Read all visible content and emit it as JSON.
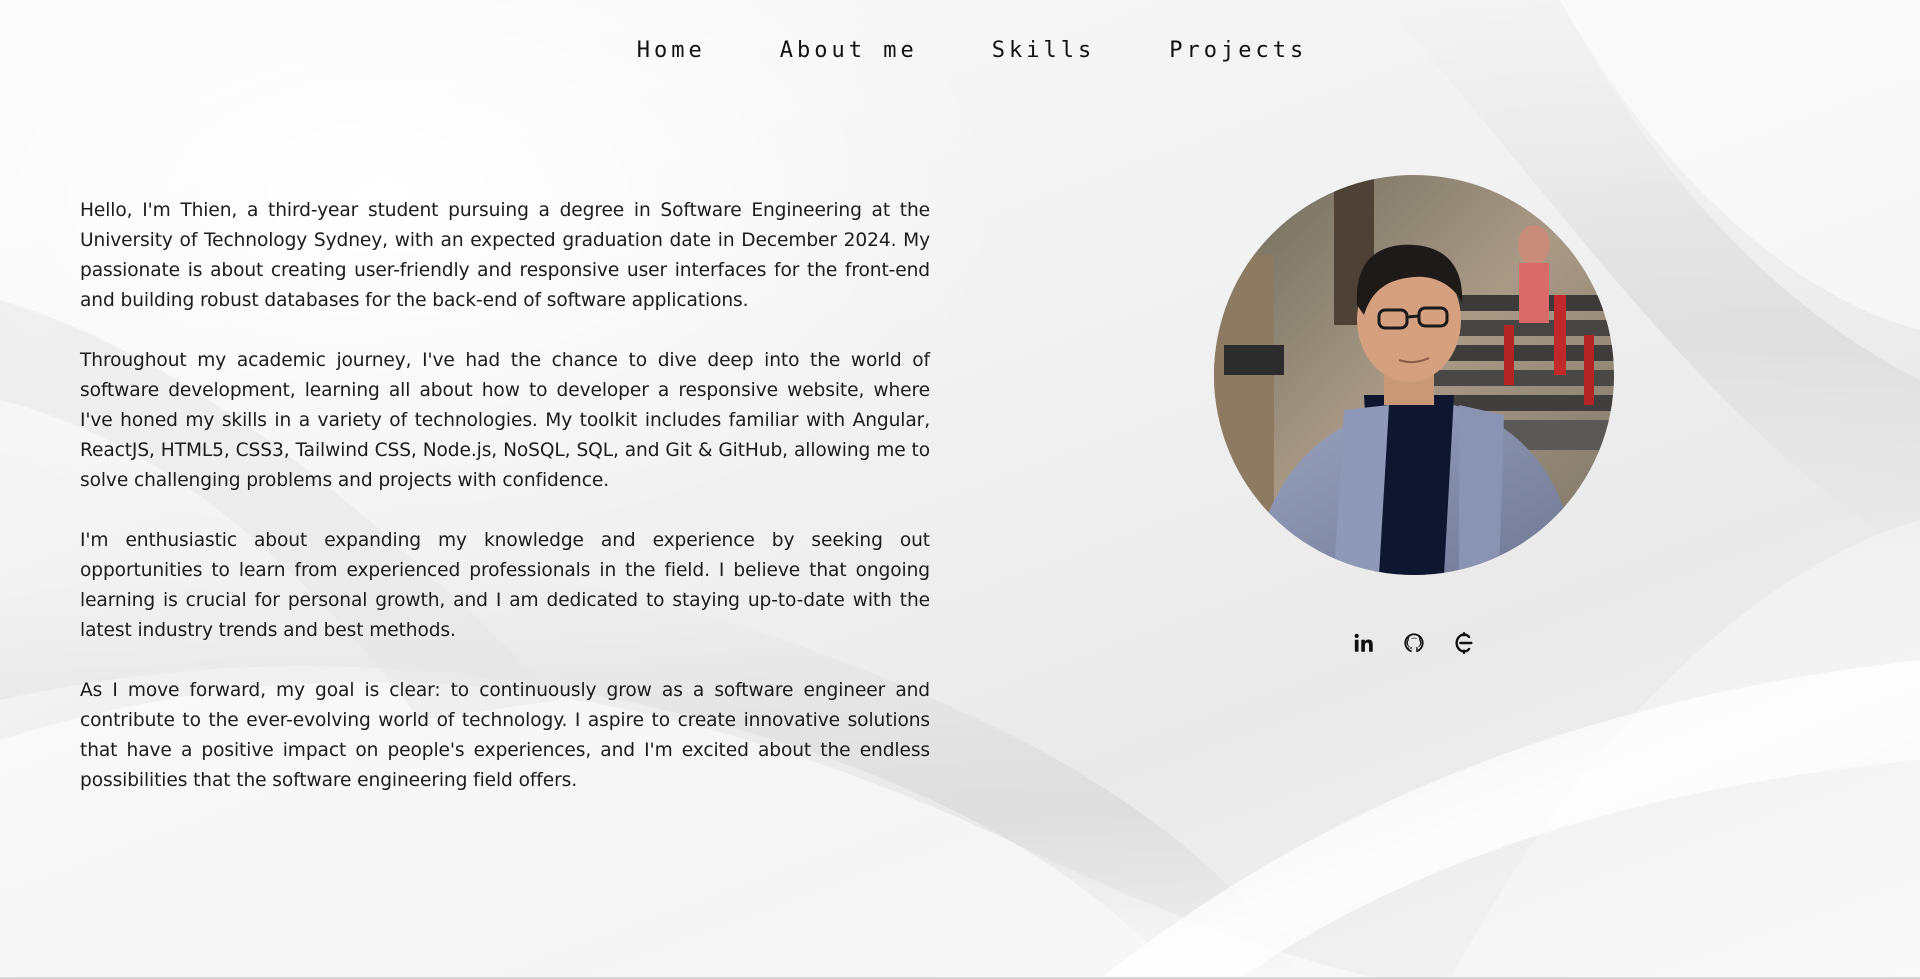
{
  "nav": {
    "items": [
      {
        "label": "Home"
      },
      {
        "label": "About me"
      },
      {
        "label": "Skills"
      },
      {
        "label": "Projects"
      }
    ]
  },
  "about": {
    "paragraphs": [
      "Hello, I'm Thien, a third-year student pursuing a degree in Software Engineering at the University of Technology Sydney, with an expected graduation date in December 2024. My passionate is about creating user-friendly and responsive user interfaces for the front-end and building robust databases for the back-end of software applications.",
      "Throughout my academic journey, I've had the chance to dive deep into the world of software development, learning all about how to developer a responsive website, where I've honed my skills in a variety of technologies. My toolkit includes familiar with Angular, ReactJS, HTML5, CSS3, Tailwind CSS, Node.js, NoSQL, SQL, and Git & GitHub, allowing me to solve challenging problems and projects with confidence.",
      "I'm enthusiastic about expanding my knowledge and experience by seeking out opportunities to learn from experienced professionals in the field. I believe that ongoing learning is crucial for personal growth, and I am dedicated to staying up-to-date with the latest industry trends and best methods.",
      "As I move forward, my goal is clear: to continuously grow as a software engineer and contribute to the ever-evolving world of technology. I aspire to create innovative solutions that have a positive impact on people's experiences, and I'm excited about the endless possibilities that the software engineering field offers."
    ]
  },
  "profile": {
    "photo_icon": "profile-photo"
  },
  "social": {
    "icons": [
      "linkedin-icon",
      "github-icon",
      "codecademy-icon"
    ]
  },
  "colors": {
    "text": "#1b1b1b",
    "background": "#f4f4f4",
    "icon": "#111111"
  }
}
